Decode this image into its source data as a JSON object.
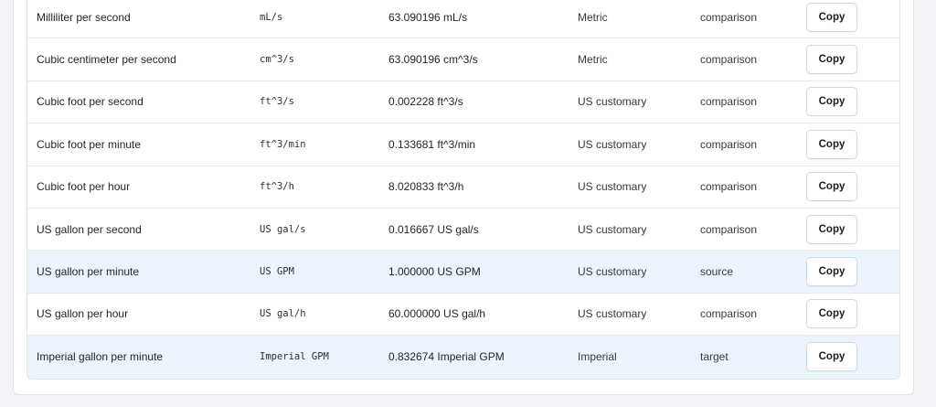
{
  "table": {
    "rows": [
      {
        "name": "Milliliter per second",
        "symbol": "mL/s",
        "value": "63.090196 mL/s",
        "system": "Metric",
        "role": "comparison",
        "action": "Copy",
        "highlight": false
      },
      {
        "name": "Cubic centimeter per second",
        "symbol": "cm^3/s",
        "value": "63.090196 cm^3/s",
        "system": "Metric",
        "role": "comparison",
        "action": "Copy",
        "highlight": false
      },
      {
        "name": "Cubic foot per second",
        "symbol": "ft^3/s",
        "value": "0.002228 ft^3/s",
        "system": "US customary",
        "role": "comparison",
        "action": "Copy",
        "highlight": false
      },
      {
        "name": "Cubic foot per minute",
        "symbol": "ft^3/min",
        "value": "0.133681 ft^3/min",
        "system": "US customary",
        "role": "comparison",
        "action": "Copy",
        "highlight": false
      },
      {
        "name": "Cubic foot per hour",
        "symbol": "ft^3/h",
        "value": "8.020833 ft^3/h",
        "system": "US customary",
        "role": "comparison",
        "action": "Copy",
        "highlight": false
      },
      {
        "name": "US gallon per second",
        "symbol": "US gal/s",
        "value": "0.016667 US gal/s",
        "system": "US customary",
        "role": "comparison",
        "action": "Copy",
        "highlight": false
      },
      {
        "name": "US gallon per minute",
        "symbol": "US GPM",
        "value": "1.000000 US GPM",
        "system": "US customary",
        "role": "source",
        "action": "Copy",
        "highlight": true
      },
      {
        "name": "US gallon per hour",
        "symbol": "US gal/h",
        "value": "60.000000 US gal/h",
        "system": "US customary",
        "role": "comparison",
        "action": "Copy",
        "highlight": false
      },
      {
        "name": "Imperial gallon per minute",
        "symbol": "Imperial GPM",
        "value": "0.832674 Imperial GPM",
        "system": "Imperial",
        "role": "target",
        "action": "Copy",
        "highlight": true
      }
    ]
  },
  "colors": {
    "highlight_row": "#ebf3fd",
    "border": "#e1e5ea",
    "page_background": "#f1f3f6"
  }
}
